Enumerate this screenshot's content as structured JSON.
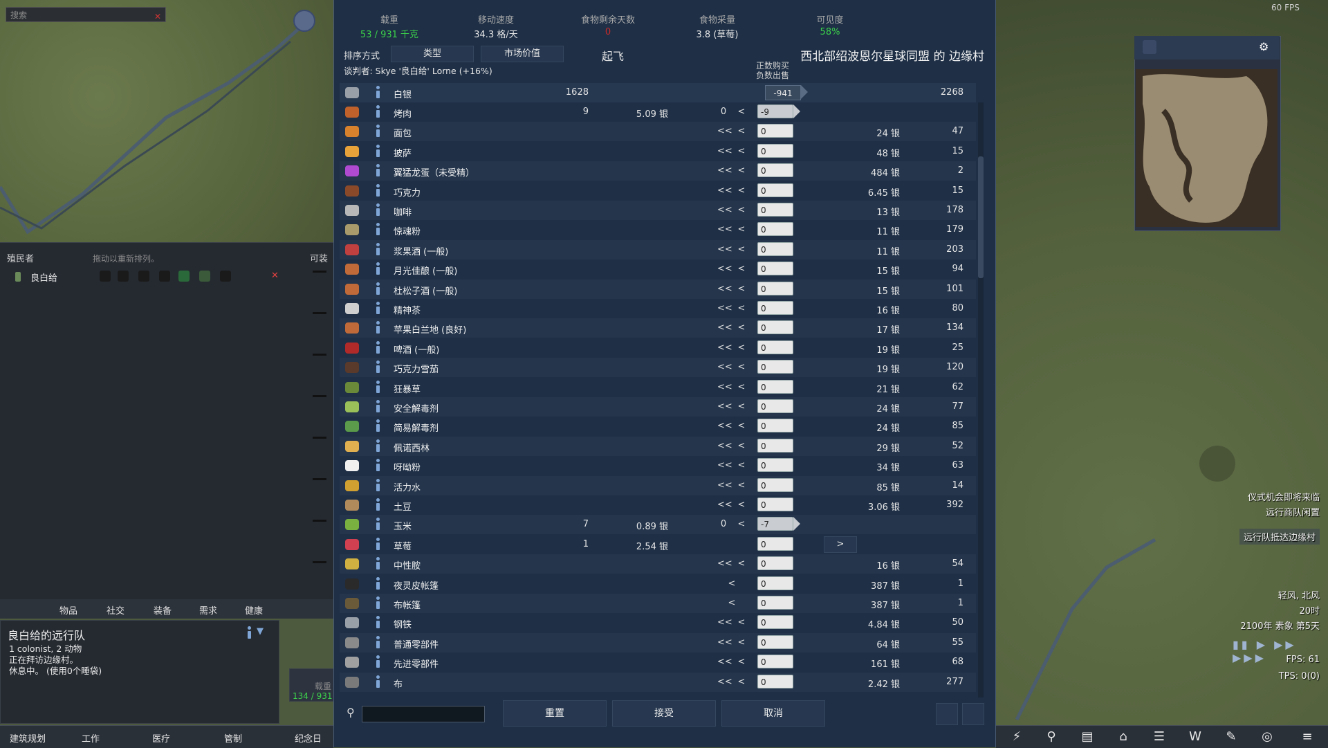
{
  "world_search": {
    "placeholder": "搜索"
  },
  "colonist_panel": {
    "header": "殖民者",
    "drag_hint": "拖动以重新排列。",
    "equip_header": "可装",
    "colonist_name": "良白给"
  },
  "panel_tabs": [
    "物品",
    "社交",
    "装备",
    "需求",
    "健康"
  ],
  "caravan": {
    "title": "良白给的远行队",
    "line1": "1 colonist, 2 动物",
    "line2": "正在拜访边缘村。",
    "line3": "休息中。 (使用0个睡袋)",
    "mini_mass_label": "载重",
    "mini_mass_value": "134 / 931"
  },
  "bottom_bar": [
    "建筑规划",
    "工作",
    "医疗",
    "管制",
    "纪念日"
  ],
  "trade": {
    "stats": [
      {
        "label": "载重",
        "value": "53 / 931 千克",
        "color": "#3cd24a"
      },
      {
        "label": "移动速度",
        "value": "34.3 格/天",
        "color": "#e6e6e6"
      },
      {
        "label": "食物剩余天数",
        "value": "0",
        "color": "#cc2a2a"
      },
      {
        "label": "食物采量",
        "value": "3.8 (草莓)",
        "color": "#e6e6e6"
      },
      {
        "label": "可见度",
        "value": "58%",
        "color": "#3cd24a"
      }
    ],
    "sort_label": "排序方式",
    "sort_buttons": [
      "类型",
      "市场价值"
    ],
    "takeoff": "起飞",
    "settlement": "西北部绍波恩尔星球同盟 的 边缘村",
    "negotiator": "谈判者: Skye '良白给' Lorne (+16%)",
    "buysell_hint_line1": "正数购买",
    "buysell_hint_line2": "负数出售",
    "silver": {
      "name": "白银",
      "colony": "1628",
      "delta": "-941",
      "trader": "2268"
    },
    "rows": [
      {
        "name": "烤肉",
        "colony_count": "9",
        "colony_price": "5.09 银",
        "zero": "0",
        "lt": "<",
        "qty": "-9",
        "trader_price": "",
        "trader_count": "",
        "color": "#c0602a"
      },
      {
        "name": "面包",
        "ll": "<<",
        "lt": "<",
        "qty": "0",
        "trader_price": "24 银",
        "trader_count": "47",
        "color": "#d8822e"
      },
      {
        "name": "披萨",
        "ll": "<<",
        "lt": "<",
        "qty": "0",
        "trader_price": "48 银",
        "trader_count": "15",
        "color": "#e8a23a"
      },
      {
        "name": "翼猛龙蛋（未受精）",
        "ll": "<<",
        "lt": "<",
        "qty": "0",
        "trader_price": "484 银",
        "trader_count": "2",
        "color": "#b04ad0"
      },
      {
        "name": "巧克力",
        "ll": "<<",
        "lt": "<",
        "qty": "0",
        "trader_price": "6.45 银",
        "trader_count": "15",
        "color": "#8a4a2a"
      },
      {
        "name": "咖啡",
        "ll": "<<",
        "lt": "<",
        "qty": "0",
        "trader_price": "13 银",
        "trader_count": "178",
        "color": "#b8b8b8"
      },
      {
        "name": "惊魂粉",
        "ll": "<<",
        "lt": "<",
        "qty": "0",
        "trader_price": "11 银",
        "trader_count": "179",
        "color": "#a89a6a"
      },
      {
        "name": "浆果酒 (一般)",
        "ll": "<<",
        "lt": "<",
        "qty": "0",
        "trader_price": "11 银",
        "trader_count": "203",
        "color": "#c04040"
      },
      {
        "name": "月光佳酿 (一般)",
        "ll": "<<",
        "lt": "<",
        "qty": "0",
        "trader_price": "15 银",
        "trader_count": "94",
        "color": "#c06a3a"
      },
      {
        "name": "杜松子酒 (一般)",
        "ll": "<<",
        "lt": "<",
        "qty": "0",
        "trader_price": "15 银",
        "trader_count": "101",
        "color": "#c06a3a"
      },
      {
        "name": "精神茶",
        "ll": "<<",
        "lt": "<",
        "qty": "0",
        "trader_price": "16 银",
        "trader_count": "80",
        "color": "#cfcfcf"
      },
      {
        "name": "苹果白兰地 (良好)",
        "ll": "<<",
        "lt": "<",
        "qty": "0",
        "trader_price": "17 银",
        "trader_count": "134",
        "color": "#c06a3a"
      },
      {
        "name": "啤酒 (一般)",
        "ll": "<<",
        "lt": "<",
        "qty": "0",
        "trader_price": "19 银",
        "trader_count": "25",
        "color": "#b02a2a"
      },
      {
        "name": "巧克力雪茄",
        "ll": "<<",
        "lt": "<",
        "qty": "0",
        "trader_price": "19 银",
        "trader_count": "120",
        "color": "#5a3a2a"
      },
      {
        "name": "狂暴草",
        "ll": "<<",
        "lt": "<",
        "qty": "0",
        "trader_price": "21 银",
        "trader_count": "62",
        "color": "#6a8a3a"
      },
      {
        "name": "安全解毒剂",
        "ll": "<<",
        "lt": "<",
        "qty": "0",
        "trader_price": "24 银",
        "trader_count": "77",
        "color": "#9ac05a"
      },
      {
        "name": "简易解毒剂",
        "ll": "<<",
        "lt": "<",
        "qty": "0",
        "trader_price": "24 银",
        "trader_count": "85",
        "color": "#5a9a4a"
      },
      {
        "name": "佩诺西林",
        "ll": "<<",
        "lt": "<",
        "qty": "0",
        "trader_price": "29 银",
        "trader_count": "52",
        "color": "#e0b050"
      },
      {
        "name": "呀呦粉",
        "ll": "<<",
        "lt": "<",
        "qty": "0",
        "trader_price": "34 银",
        "trader_count": "63",
        "color": "#f0f0f0"
      },
      {
        "name": "活力水",
        "ll": "<<",
        "lt": "<",
        "qty": "0",
        "trader_price": "85 银",
        "trader_count": "14",
        "color": "#d0a030"
      },
      {
        "name": "土豆",
        "ll": "<<",
        "lt": "<",
        "qty": "0",
        "trader_price": "3.06 银",
        "trader_count": "392",
        "color": "#b08a5a"
      },
      {
        "name": "玉米",
        "colony_count": "7",
        "colony_price": "0.89 银",
        "zero": "0",
        "lt": "<",
        "qty": "-7",
        "trader_price": "",
        "trader_count": "",
        "color": "#7ab040"
      },
      {
        "name": "草莓",
        "colony_count": "1",
        "colony_price": "2.54 银",
        "qty": "0",
        "gt": ">",
        "trader_price": "",
        "trader_count": "",
        "color": "#d04050"
      },
      {
        "name": "中性胺",
        "ll": "<<",
        "lt": "<",
        "qty": "0",
        "trader_price": "16 银",
        "trader_count": "54",
        "color": "#d0b040"
      },
      {
        "name": "夜灵皮帐篷",
        "lt": "<",
        "qty": "0",
        "trader_price": "387 银",
        "trader_count": "1",
        "color": "#2a2a2a"
      },
      {
        "name": "布帐篷",
        "lt": "<",
        "qty": "0",
        "trader_price": "387 银",
        "trader_count": "1",
        "color": "#6a5a3a"
      },
      {
        "name": "钢铁",
        "ll": "<<",
        "lt": "<",
        "qty": "0",
        "trader_price": "4.84 银",
        "trader_count": "50",
        "color": "#9aa0a8"
      },
      {
        "name": "普通零部件",
        "ll": "<<",
        "lt": "<",
        "qty": "0",
        "trader_price": "64 银",
        "trader_count": "55",
        "color": "#8a8a8a"
      },
      {
        "name": "先进零部件",
        "ll": "<<",
        "lt": "<",
        "qty": "0",
        "trader_price": "161 银",
        "trader_count": "68",
        "color": "#a0a0a0"
      },
      {
        "name": "布",
        "ll": "<<",
        "lt": "<",
        "qty": "0",
        "trader_price": "2.42 银",
        "trader_count": "277",
        "color": "#7a7a7a"
      }
    ],
    "buttons": {
      "reset": "重置",
      "accept": "接受",
      "cancel": "取消"
    }
  },
  "hud": {
    "fps_top": "60 FPS",
    "alert1": "仪式机会即将来临",
    "alert2": "远行商队闲置",
    "alert3": "远行队抵达边缘村",
    "weather": "轻风, 北风",
    "time": "20时",
    "date": "2100年 素象 第5天",
    "fps": "FPS: 61",
    "tps": "TPS: 0(0)"
  }
}
